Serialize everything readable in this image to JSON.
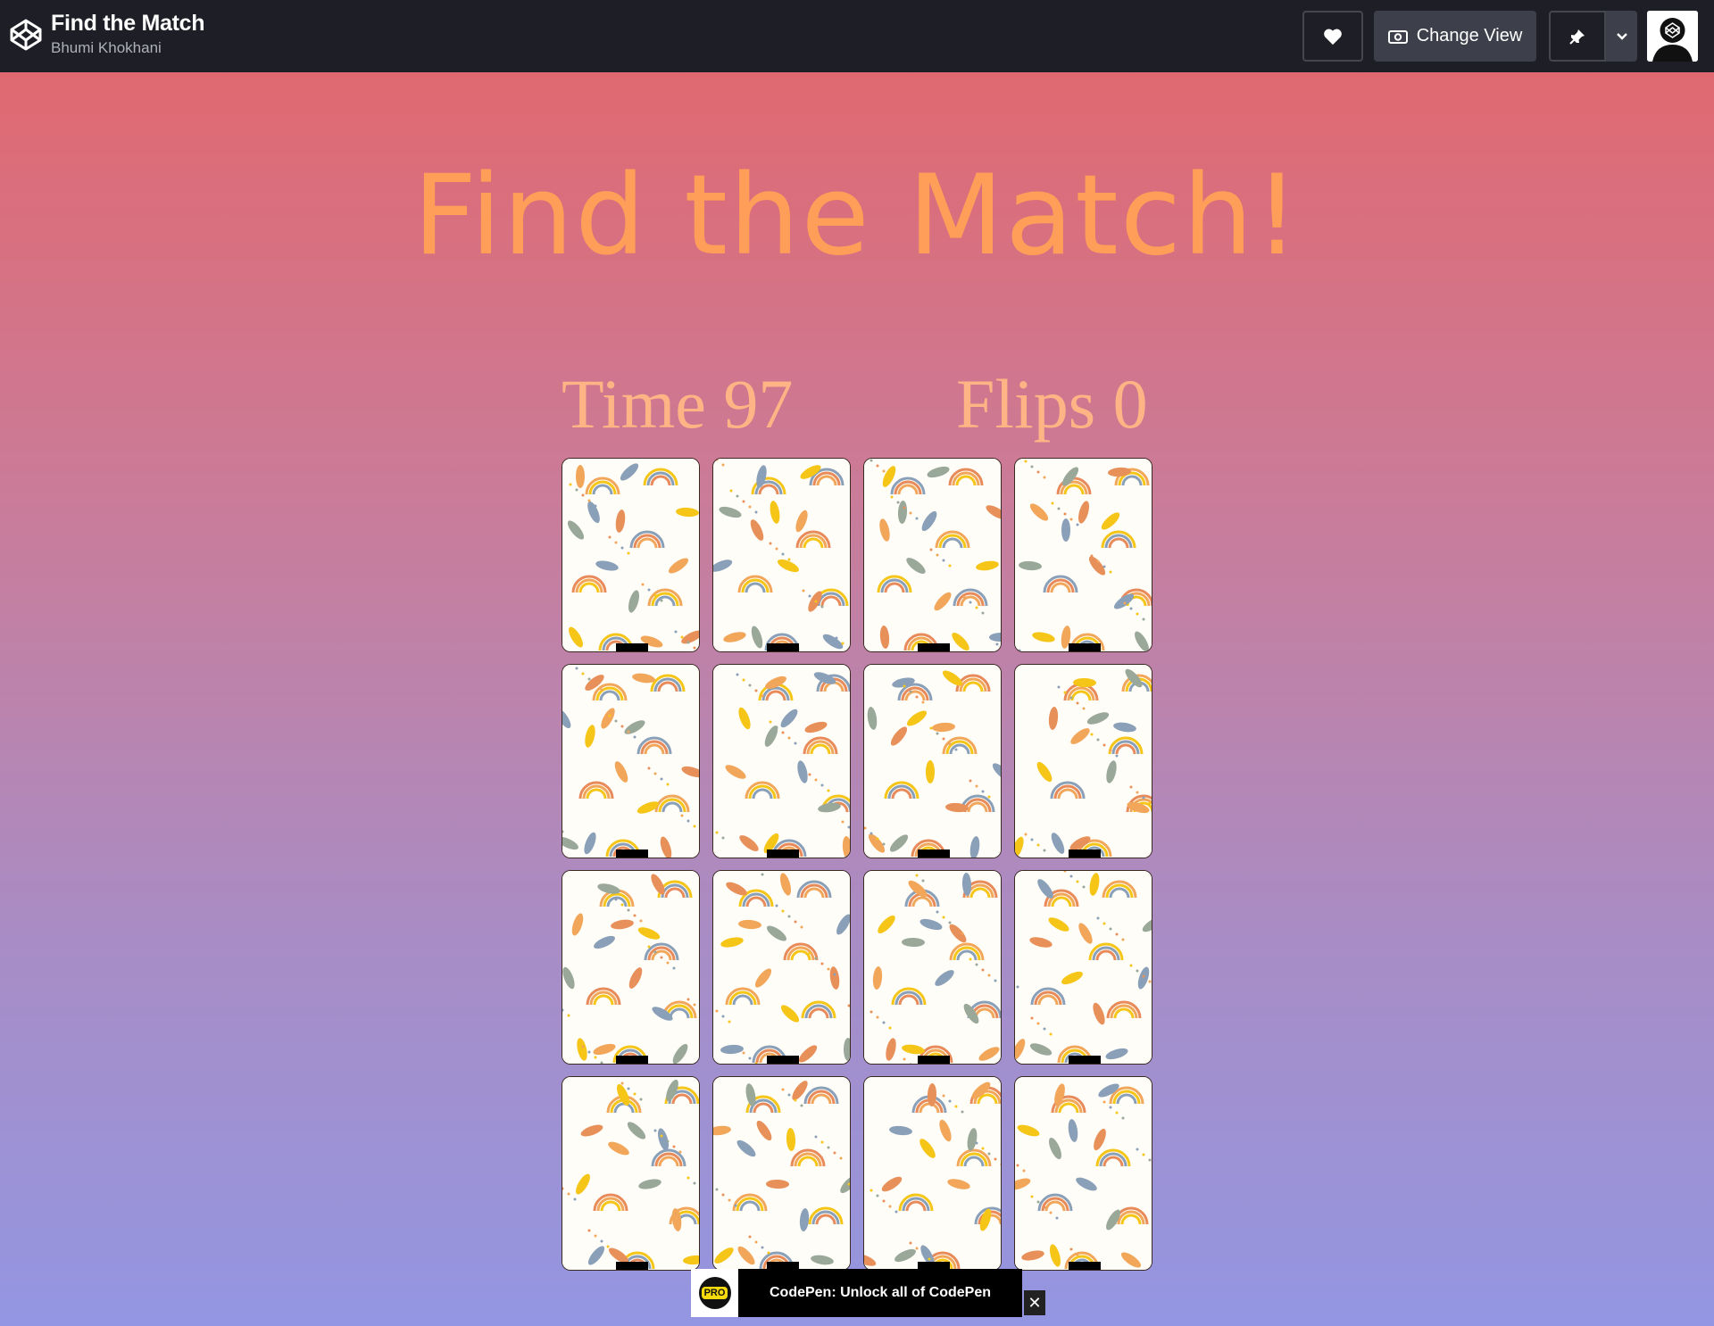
{
  "header": {
    "title": "Find the Match",
    "author": "Bhumi Khokhani",
    "change_view_label": "Change View",
    "icons": [
      "codepen-logo-icon",
      "heart-icon",
      "eye-icon",
      "pin-icon",
      "chevron-down-icon",
      "avatar"
    ]
  },
  "game": {
    "heading": "Find the Match!",
    "time_label": "Time 97",
    "flips_label": "Flips 0",
    "card_count": 16
  },
  "promo": {
    "badge": "PRO",
    "text": "CodePen: Unlock all of CodePen",
    "close": "✕"
  },
  "colors": {
    "accent": "#ff9e58",
    "stats": "#ffb485",
    "topbar": "#1e1f26"
  }
}
